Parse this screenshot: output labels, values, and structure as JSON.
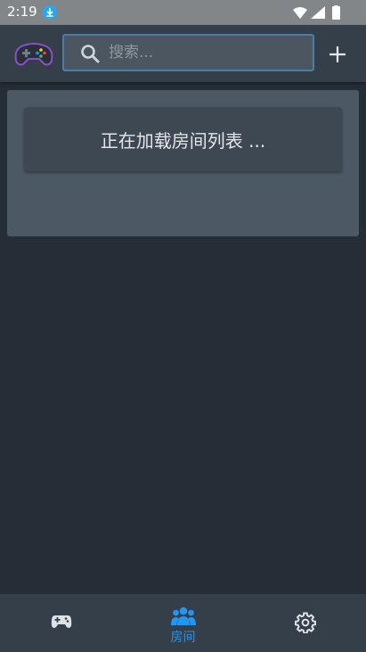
{
  "status_bar": {
    "time": "2:19",
    "icons": [
      "download-icon",
      "wifi-icon",
      "signal-icon",
      "battery-icon"
    ]
  },
  "app_bar": {
    "logo_icon": "gamepad-logo",
    "search": {
      "placeholder": "搜索...",
      "value": ""
    },
    "add_icon": "plus-icon"
  },
  "room_list": {
    "loading_text": "正在加载房间列表 ..."
  },
  "bottom_nav": {
    "items": [
      {
        "icon": "gamepad-icon",
        "label": "",
        "active": false
      },
      {
        "icon": "people-icon",
        "label": "房间",
        "active": true
      },
      {
        "icon": "gear-icon",
        "label": "",
        "active": false
      }
    ]
  },
  "colors": {
    "background": "#252e37",
    "app_bar": "#353f49",
    "panel": "#4c5863",
    "card": "#3e4852",
    "accent": "#2196f3",
    "search_border": "#4e7ea8"
  }
}
